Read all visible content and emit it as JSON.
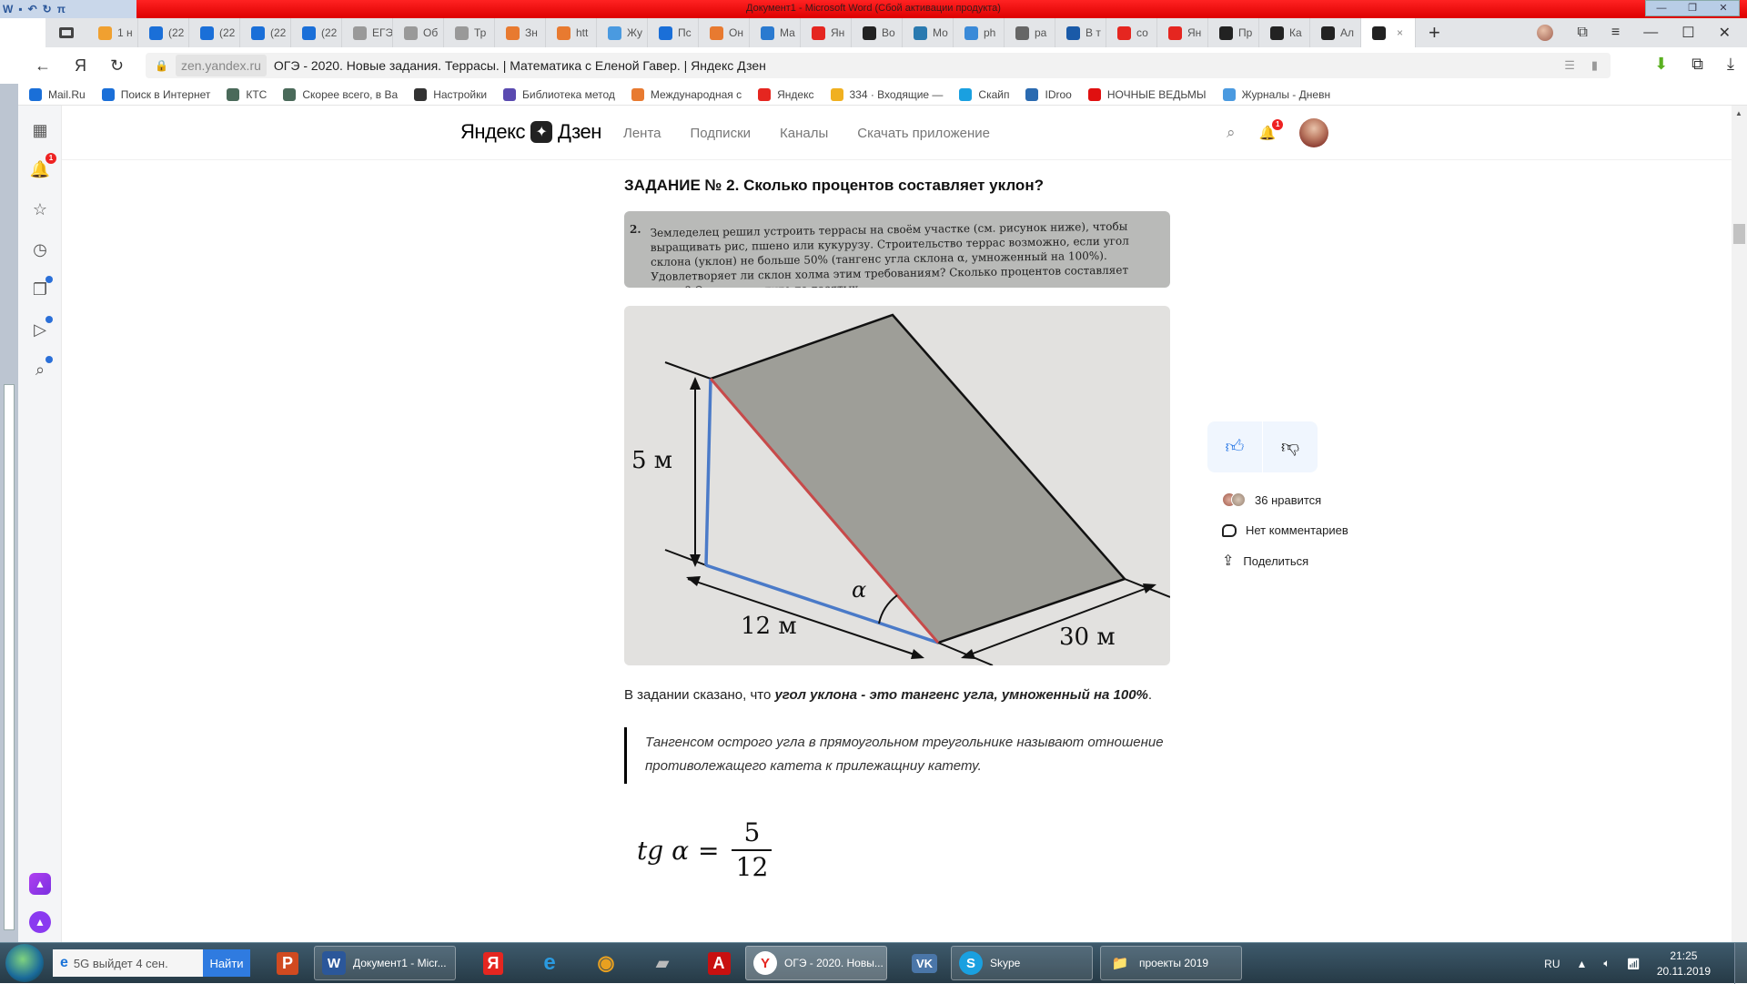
{
  "word": {
    "title": "Документ1 - Microsoft Word (Сбой активации продукта)",
    "quick_access": [
      "W",
      "save",
      "undo",
      "redo",
      "π"
    ],
    "controls": [
      "minimize",
      "restore",
      "close"
    ]
  },
  "browser": {
    "tabs": [
      {
        "label": "1 н",
        "icon": "mail-orange",
        "color": "#f0a030"
      },
      {
        "label": "(22",
        "icon": "mail-blue",
        "color": "#1a6fd8"
      },
      {
        "label": "(22",
        "icon": "mail-blue",
        "color": "#1a6fd8"
      },
      {
        "label": "(22",
        "icon": "mail-blue",
        "color": "#1a6fd8"
      },
      {
        "label": "(22",
        "icon": "mail-blue",
        "color": "#1a6fd8"
      },
      {
        "label": "ЕГЭ",
        "icon": "page-gray",
        "color": "#999999"
      },
      {
        "label": "Об",
        "icon": "page-gray",
        "color": "#999999"
      },
      {
        "label": "Тр",
        "icon": "page-gray",
        "color": "#999999"
      },
      {
        "label": "Зн",
        "icon": "fox",
        "color": "#e87a30"
      },
      {
        "label": "htt",
        "icon": "fox",
        "color": "#e87a30"
      },
      {
        "label": "Жу",
        "icon": "hand",
        "color": "#4a9ae0"
      },
      {
        "label": "Пс",
        "icon": "mail-blue",
        "color": "#1a6fd8"
      },
      {
        "label": "Он",
        "icon": "fox",
        "color": "#e87a30"
      },
      {
        "label": "Ма",
        "icon": "globe",
        "color": "#2a7ad0"
      },
      {
        "label": "Ян",
        "icon": "yandex",
        "color": "#e52620"
      },
      {
        "label": "Во",
        "icon": "zen",
        "color": "#222222"
      },
      {
        "label": "Мо",
        "icon": "book",
        "color": "#2a7ab0"
      },
      {
        "label": "ph",
        "icon": "doc",
        "color": "#3a8ad8"
      },
      {
        "label": "ра",
        "icon": "file",
        "color": "#666666"
      },
      {
        "label": "В т",
        "icon": "ege2020",
        "color": "#1a5aa8"
      },
      {
        "label": "со",
        "icon": "yandex",
        "color": "#e52620"
      },
      {
        "label": "Ян",
        "icon": "yandex",
        "color": "#e52620"
      },
      {
        "label": "Пр",
        "icon": "zen",
        "color": "#222222"
      },
      {
        "label": "Ка",
        "icon": "zen",
        "color": "#222222"
      },
      {
        "label": "Ал",
        "icon": "zen",
        "color": "#222222"
      },
      {
        "label": "",
        "icon": "zen",
        "color": "#222222",
        "active": true
      }
    ],
    "new_tab": "+",
    "address": {
      "domain": "zen.yandex.ru",
      "page_title": "ОГЭ - 2020. Новые задания. Террасы. | Математика с Еленой Гавер. | Яндекс Дзен"
    },
    "bookmarks": [
      {
        "label": "Mail.Ru",
        "color": "#1a6fd8"
      },
      {
        "label": "Поиск в Интернет",
        "color": "#1a6fd8"
      },
      {
        "label": "КТС",
        "color": "#4a6a5a"
      },
      {
        "label": "Скорее всего, в Ва",
        "color": "#4a6a5a"
      },
      {
        "label": "Настройки",
        "color": "#333333"
      },
      {
        "label": "Библиотека метод",
        "color": "#5a4ab0"
      },
      {
        "label": "Международная с",
        "color": "#e87a30"
      },
      {
        "label": "Яндекс",
        "color": "#e52620"
      },
      {
        "label": "334 · Входящие —",
        "color": "#f0b020"
      },
      {
        "label": "Скайп",
        "color": "#1aa0e0"
      },
      {
        "label": "IDroo",
        "color": "#2a6ab0"
      },
      {
        "label": "НОЧНЫЕ ВЕДЬМЫ",
        "color": "#e01010"
      },
      {
        "label": "Журналы - Дневн",
        "color": "#4a9ae0"
      }
    ]
  },
  "sidebar": {
    "items": [
      {
        "name": "services",
        "glyph": "▦"
      },
      {
        "name": "notifications",
        "glyph": "🔔",
        "badge": "1"
      },
      {
        "name": "favorites",
        "glyph": "☆"
      },
      {
        "name": "history",
        "glyph": "◷"
      },
      {
        "name": "collections",
        "glyph": "❐",
        "dot": true
      },
      {
        "name": "video",
        "glyph": "▷",
        "dot": true
      },
      {
        "name": "search-doc",
        "glyph": "⌕",
        "dot": true
      }
    ]
  },
  "zen": {
    "logo_left": "Яндекс",
    "logo_right": "Дзен",
    "nav": [
      "Лента",
      "Подписки",
      "Каналы",
      "Скачать приложение"
    ],
    "notif_badge": "1"
  },
  "article": {
    "heading": "ЗАДАНИЕ № 2. Сколько процентов составляет уклон?",
    "scan_number": "2.",
    "scan_text": "Земледелец решил устроить террасы на своём участке (см. рисунок ниже), чтобы выращивать рис, пшено или кукурузу. Строительство террас возможно, если угол склона (уклон) не больше 50% (тангенс угла склона α, умноженный на 100%). Удовлетворяет ли склон холма этим требованиям? Сколько процентов составляет уклон? Ответ округлите до десятых.",
    "diagram": {
      "height_label": "5 м",
      "base_label": "12 м",
      "length_label": "30 м",
      "angle_label": "α"
    },
    "para_plain": "В задании сказано, что ",
    "para_bold": "угол уклона - это тангенс угла, умноженный на 100%",
    "para_end": ".",
    "quote": "Тангенсом острого угла в прямоугольном треугольнике называют отношение противолежащего катета к прилежащниу катету.",
    "formula": {
      "lhs": "tg α",
      "eq": "=",
      "numerator": "5",
      "denominator": "12"
    }
  },
  "reactions": {
    "likes": "36 нравится",
    "comments": "Нет комментариев",
    "share": "Поделиться"
  },
  "taskbar": {
    "search_text": "5G выйдет 4 сен.",
    "search_button": "Найти",
    "windows": [
      {
        "label": "Документ1 - Micr...",
        "icon": "W",
        "color": "#2b579a"
      },
      {
        "label": "ОГЭ - 2020. Новы...",
        "icon": "Y",
        "color": "#e52620",
        "active": true
      },
      {
        "label": "Skype",
        "icon": "S",
        "color": "#1aa0e0"
      },
      {
        "label": "проекты 2019",
        "icon": "📁",
        "color": "#e8c050"
      }
    ],
    "pinned": [
      {
        "name": "powerpoint",
        "glyph": "P",
        "color": "#d04a20"
      },
      {
        "name": "yandex-browser",
        "glyph": "Я",
        "color": "#e52620"
      },
      {
        "name": "internet-explorer",
        "glyph": "e",
        "color": "#2a9ae0"
      },
      {
        "name": "chrome-like",
        "glyph": "◉",
        "color": "#e8a020"
      },
      {
        "name": "app-misc",
        "glyph": "▰",
        "color": "#888888"
      },
      {
        "name": "acrobat",
        "glyph": "A",
        "color": "#c81010"
      },
      {
        "name": "vk",
        "glyph": "VK",
        "color": "#4a76a8"
      }
    ],
    "lang": "RU",
    "time": "21:25",
    "date": "20.11.2019"
  }
}
